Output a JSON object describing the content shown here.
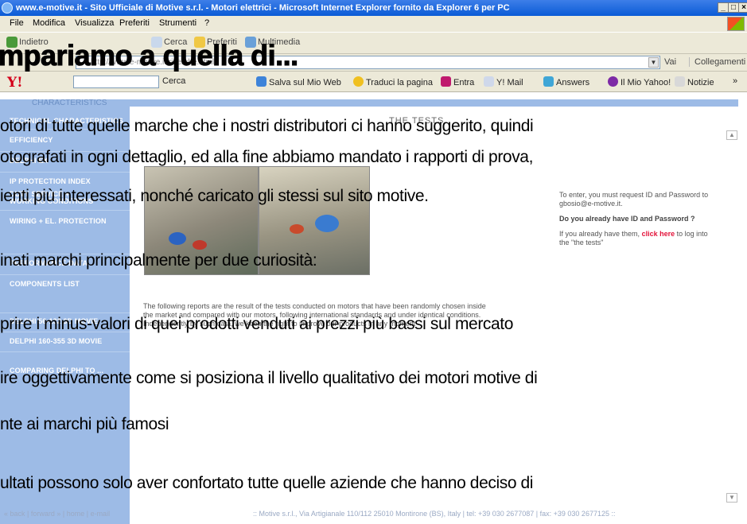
{
  "window": {
    "title": "www.e-motive.it - Sito Ufficiale di Motive s.r.l. - Motori elettrici - Microsoft Internet Explorer fornito da Explorer 6 per PC",
    "min": "_",
    "max": "□",
    "close": "×"
  },
  "menu": [
    "File",
    "Modifica",
    "Visualizza",
    "Preferiti",
    "Strumenti",
    "?"
  ],
  "toolbar": {
    "back": "Indietro",
    "search": "Cerca",
    "favorites": "Preferiti",
    "media": "Multimedia"
  },
  "address": {
    "value": "http://www.e-motive.it/ricerche.html",
    "go": "Vai",
    "links": "Collegamenti »"
  },
  "yahoo": {
    "logo": "Y!",
    "search": "Cerca",
    "save": "Salva sul Mio Web",
    "translate": "Traduci la pagina",
    "enter": "Entra",
    "mail": "Y! Mail",
    "answers": "Answers",
    "myyahoo": "Il Mio Yahoo!",
    "news": "Notizie",
    "more": "»"
  },
  "page": {
    "strip_title": "CHARACTERISTICS",
    "tests_title": "THE TESTS",
    "nav": [
      "TECHNICAL CHARACTERISTICS",
      "EFFICIENCY",
      "DELPHI EX",
      "IP PROTECTION INDEX",
      "DUTY SERVICE +",
      "WORKING CONDITIONS",
      "WIRING + EL. PROTECTION",
      "PERFORMANCE DATA",
      "COMPONENTS LIST",
      "DELPHI 56-132 3D MOVIE",
      "DELPHI 160-355 3D MOVIE",
      "COMPARING DELPHI TO ..."
    ],
    "right": {
      "p1": "To enter, you must request ID and Password to gbosio@e-motive.it.",
      "q": "Do you already have ID and Password ?",
      "p3a": "If you already have them,",
      "link": "click here",
      "p3b": "to log into the \"the tests\""
    },
    "reports": {
      "line1": "The following reports are the result of the tests conducted on motors that have been randomly chosen inside",
      "line2": "the market and compared with our motors, following international standards and under identical conditions.",
      "line3": "Independently by such data, we keep the right to improve our products in any moment"
    },
    "footer_nav": "« back | forward » | home | e-mail",
    "footer_addr": ":: Motive s.r.l., Via Artigianale 110/112 25010 Montirone (BS), Italy | tel: +39 030 2677087 | fax: +39 030 2677125 ::"
  },
  "overlay": {
    "title": "mpariamo a quella di...",
    "lines": [
      "otori di tutte quelle marche che i nostri distributori ci hanno suggerito, quindi",
      "otografati in ogni dettaglio, ed alla fine abbiamo mandato i rapporti di prova,",
      "ienti più interessati, nonché caricato gli stessi sul sito motive.",
      "inati marchi principalmente per due curiosità:",
      "prire i minus-valori di quei prodotti venduti ai prezzi più bassi sul mercato",
      "ire oggettivamente come si posiziona il livello qualitativo dei motori motive di",
      "nte ai marchi più famosi",
      "ultati possono solo aver confortato tutte quelle aziende che hanno deciso di"
    ]
  }
}
